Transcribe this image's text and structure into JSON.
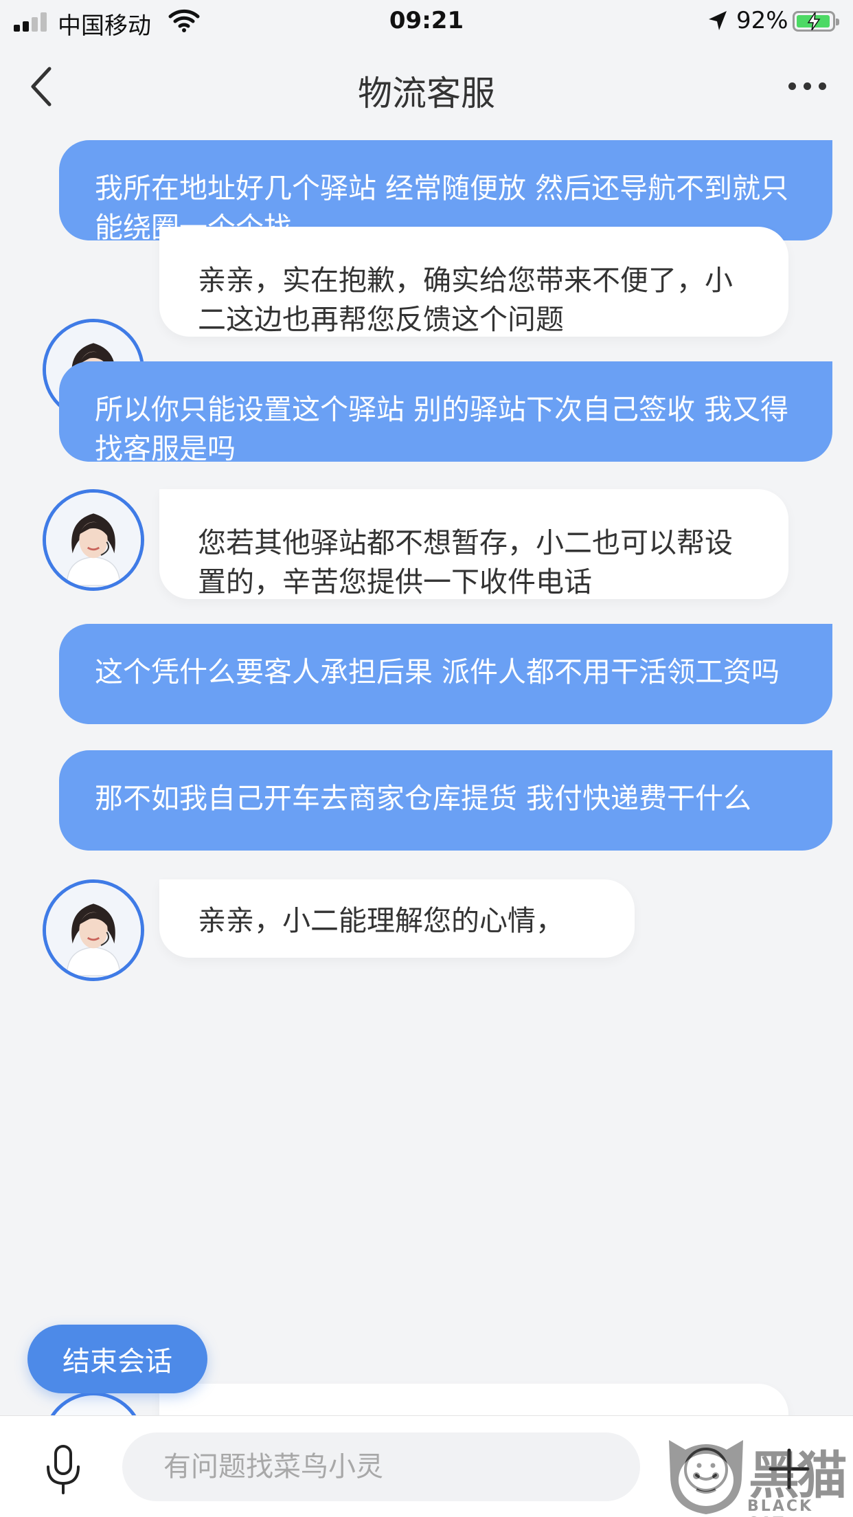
{
  "status_bar": {
    "carrier": "中国移动",
    "time": "09:21",
    "battery": "92%",
    "battery_level": 0.92,
    "signal_bars": 2
  },
  "nav": {
    "title": "物流客服"
  },
  "messages": [
    {
      "side": "out",
      "text": "我所在地址好几个驿站 经常随便放 然后还导航不到就只能绕圈一个个找"
    },
    {
      "side": "in",
      "text": "亲亲，实在抱歉，确实给您带来不便了，小二这边也再帮您反馈这个问题"
    },
    {
      "side": "out",
      "text": "所以你只能设置这个驿站 别的驿站下次自己签收 我又得找客服是吗"
    },
    {
      "side": "in",
      "text": "您若其他驿站都不想暂存，小二也可以帮设置的，辛苦您提供一下收件电话"
    },
    {
      "side": "out",
      "text": "这个凭什么要客人承担后果 派件人都不用干活领工资吗"
    },
    {
      "side": "out",
      "text": "那不如我自己开车去商家仓库提货 我付快递费干什么"
    },
    {
      "side": "in",
      "text": "亲亲，小二能理解您的心情，"
    }
  ],
  "end_session_label": "结束会话",
  "input": {
    "placeholder": "有问题找菜鸟小灵"
  },
  "watermark": {
    "text": "黑猫",
    "subtext": "BLACK CAT"
  },
  "colors": {
    "outgoing_bubble": "#6aa0f4",
    "incoming_bubble": "#ffffff",
    "background": "#f3f4f6",
    "end_button": "#4d8ae8",
    "avatar_ring": "#3f7be6"
  },
  "icons": [
    "back-icon",
    "more-icon",
    "avatar",
    "mic-icon",
    "emoji-icon",
    "plus-icon",
    "location-arrow-icon",
    "wifi-icon",
    "signal-icon",
    "battery-icon"
  ]
}
